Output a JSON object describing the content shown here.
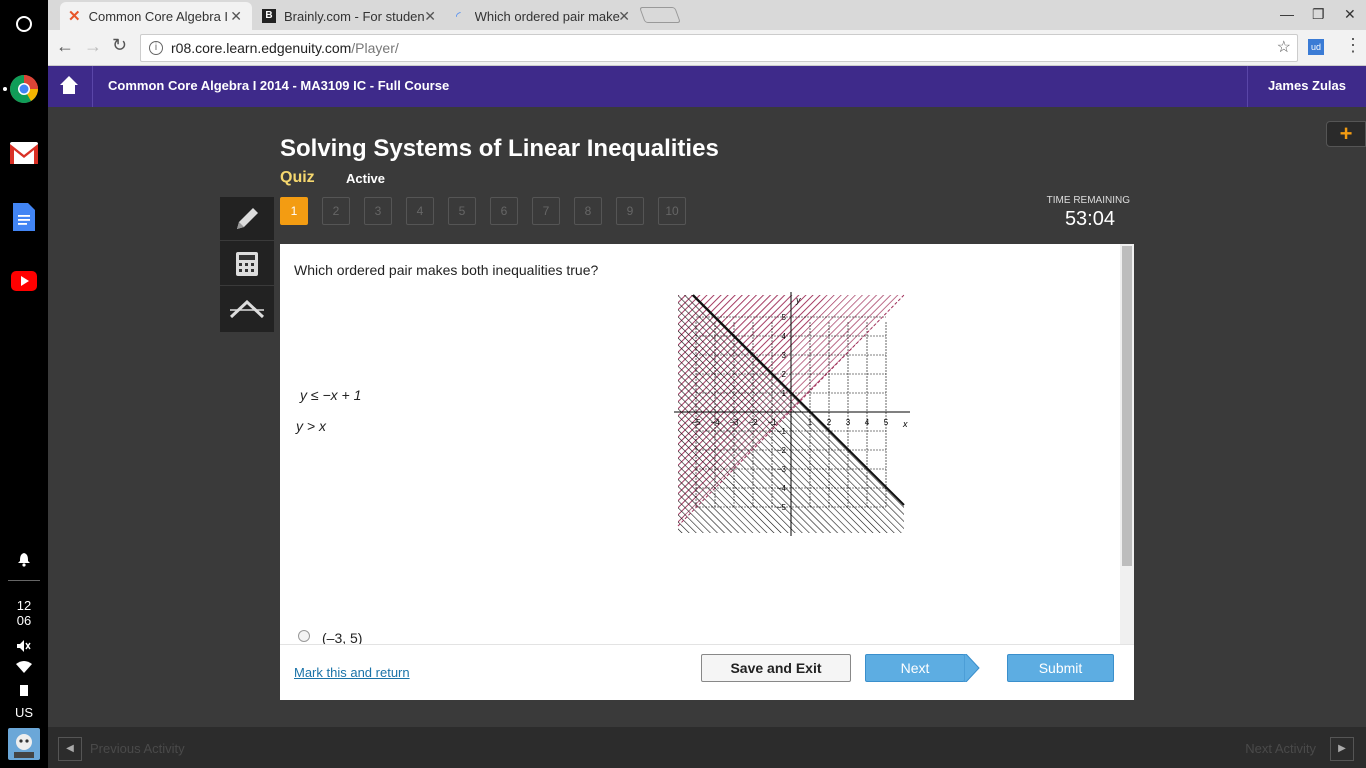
{
  "browser": {
    "tabs": [
      {
        "label": "Common Core Algebra I"
      },
      {
        "label": "Brainly.com - For studen"
      },
      {
        "label": "Which ordered pair make"
      }
    ],
    "url_host": "r08.core.learn.edgenuity.com",
    "url_path": "/Player/",
    "ext_label": "ud"
  },
  "shelf": {
    "time_hour": "12",
    "time_min": "06",
    "locale": "US"
  },
  "header": {
    "course_title": "Common Core Algebra I 2014 - MA3109 IC - Full Course",
    "user_name": "James Zulas"
  },
  "quiz": {
    "title": "Solving Systems of Linear Inequalities",
    "type_label": "Quiz",
    "status_label": "Active",
    "questions": [
      "1",
      "2",
      "3",
      "4",
      "5",
      "6",
      "7",
      "8",
      "9",
      "10"
    ],
    "current_question": 1,
    "time_remaining_label": "TIME REMAINING",
    "time_remaining": "53:04"
  },
  "question": {
    "prompt": "Which ordered pair makes both inequalities true?",
    "inequality1": "y ≤ −x + 1",
    "inequality2": "y > x",
    "choice1": "(–3, 5)"
  },
  "graph": {
    "x_label": "x",
    "y_label": "y",
    "x_ticks": [
      "−5",
      "−4",
      "−3",
      "−2",
      "−1",
      "1",
      "2",
      "3",
      "4",
      "5"
    ],
    "y_ticks": [
      "5",
      "4",
      "3",
      "2",
      "1",
      "−1",
      "−2",
      "−3",
      "−4",
      "−5"
    ]
  },
  "footer": {
    "mark_link": "Mark this and return",
    "save_exit": "Save and Exit",
    "next": "Next",
    "submit": "Submit"
  },
  "bottom": {
    "prev_activity": "Previous Activity",
    "next_activity": "Next Activity"
  },
  "colors": {
    "header_bg": "#3e2a8a",
    "accent_orange": "#f39c12",
    "quiz_yellow": "#f5d76e",
    "button_blue": "#5dade2",
    "link_blue": "#1a73a8"
  }
}
